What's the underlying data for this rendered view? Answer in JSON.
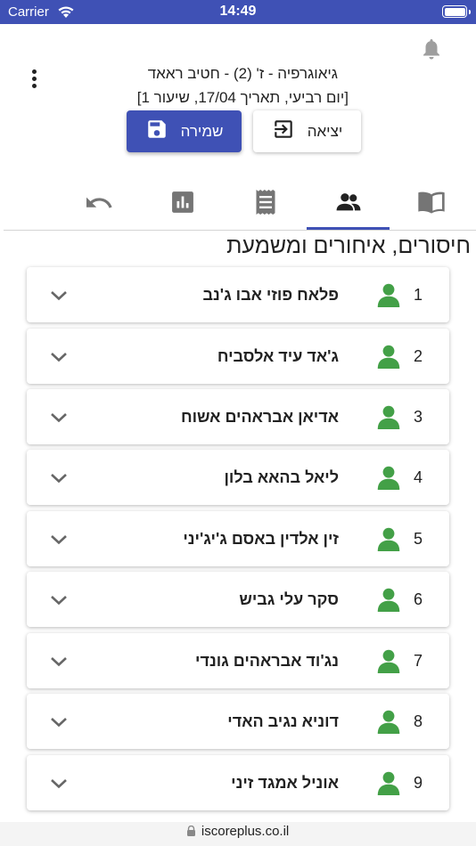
{
  "status_bar": {
    "carrier": "Carrier",
    "time": "14:49"
  },
  "header": {
    "title": "גיאוגרפיה - ז' (2) - חטיב ראאד",
    "subtitle": "[יום רביעי, תאריך 17/04, שיעור 1]",
    "save_label": "שמירה",
    "exit_label": "יציאה"
  },
  "tabs": [
    {
      "icon": "book-icon",
      "active": false
    },
    {
      "icon": "people-icon",
      "active": true
    },
    {
      "icon": "receipt-icon",
      "active": false
    },
    {
      "icon": "bar-chart-icon",
      "active": false
    },
    {
      "icon": "undo-icon",
      "active": false
    }
  ],
  "section_title": "חיסורים, איחורים ומשמעת",
  "students": [
    {
      "num": "1",
      "name": "פלאח פוזי אבו ג'נב"
    },
    {
      "num": "2",
      "name": "ג'אד עיד אלסביח"
    },
    {
      "num": "3",
      "name": "אדיאן אבראהים אשוח"
    },
    {
      "num": "4",
      "name": "ליאל בהאא בלון"
    },
    {
      "num": "5",
      "name": "זין אלדין באסם ג'יג'יני"
    },
    {
      "num": "6",
      "name": "סקר עלי גביש"
    },
    {
      "num": "7",
      "name": "נג'וד אבראהים גונדי"
    },
    {
      "num": "8",
      "name": "דוניא נגיב האדי"
    },
    {
      "num": "9",
      "name": "אוניל אמגד זיני"
    }
  ],
  "url": "iscoreplus.co.il",
  "colors": {
    "primary": "#3f51b5",
    "person_icon": "#43a047"
  }
}
